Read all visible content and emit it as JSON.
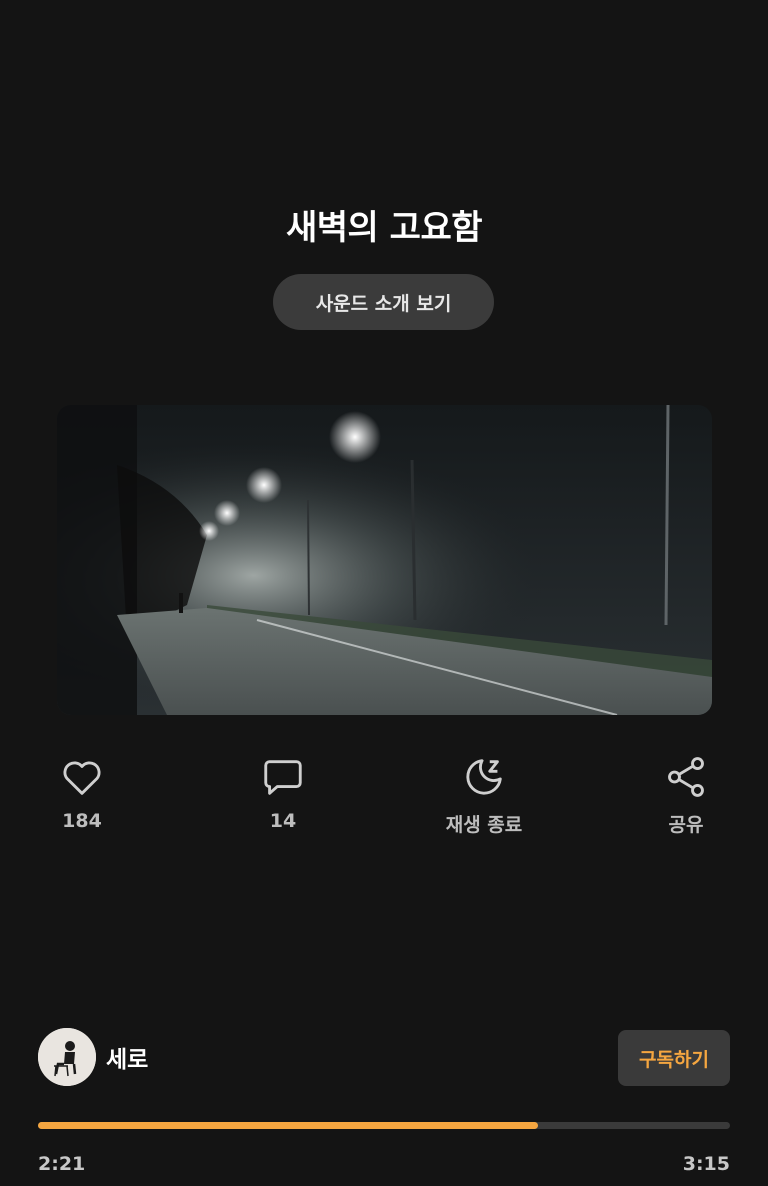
{
  "track": {
    "title": "새벽의 고요함",
    "intro_button_label": "사운드 소개 보기"
  },
  "actions": [
    {
      "icon": "heart-icon",
      "label": "184"
    },
    {
      "icon": "comment-icon",
      "label": "14"
    },
    {
      "icon": "sleep-timer-icon",
      "label": "재생 종료"
    },
    {
      "icon": "share-icon",
      "label": "공유"
    }
  ],
  "creator": {
    "name": "세로",
    "subscribe_label": "구독하기"
  },
  "player": {
    "elapsed": "2:21",
    "duration": "3:15",
    "progress_fraction": 0.723
  },
  "colors": {
    "background": "#141414",
    "accent": "#f5a640",
    "button_bg": "#3b3b3b"
  }
}
